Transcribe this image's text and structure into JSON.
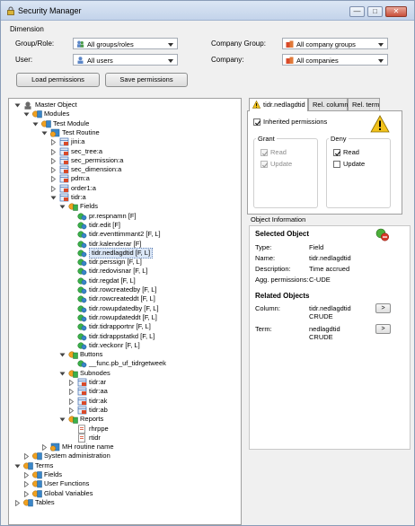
{
  "window": {
    "title": "Security Manager",
    "minimize": "—",
    "maximize": "□",
    "close": "✕"
  },
  "dimension": {
    "legend": "Dimension",
    "group_role_label": "Group/Role:",
    "group_role_value": "All groups/roles",
    "user_label": "User:",
    "user_value": "All users",
    "company_group_label": "Company Group:",
    "company_group_value": "All company groups",
    "company_label": "Company:",
    "company_value": "All companies"
  },
  "buttons": {
    "load": "Load permissions",
    "save": "Save permissions"
  },
  "tree": [
    {
      "label": "Master Object",
      "depth": 0,
      "exp": "minus",
      "icon": "master-icon"
    },
    {
      "label": "Modules",
      "depth": 1,
      "exp": "minus",
      "icon": "module-icon"
    },
    {
      "label": "Test Module",
      "depth": 2,
      "exp": "minus",
      "icon": "module-icon"
    },
    {
      "label": "Test Routine",
      "depth": 3,
      "exp": "minus",
      "icon": "routine-icon"
    },
    {
      "label": "jini:a",
      "depth": 4,
      "exp": "plus",
      "icon": "table-icon"
    },
    {
      "label": "sec_tree:a",
      "depth": 4,
      "exp": "plus",
      "icon": "table-icon"
    },
    {
      "label": "sec_permission:a",
      "depth": 4,
      "exp": "plus",
      "icon": "table-icon"
    },
    {
      "label": "sec_dimension:a",
      "depth": 4,
      "exp": "plus",
      "icon": "table-icon"
    },
    {
      "label": "pdm:a",
      "depth": 4,
      "exp": "plus",
      "icon": "table-icon"
    },
    {
      "label": "order1:a",
      "depth": 4,
      "exp": "plus",
      "icon": "table-icon"
    },
    {
      "label": "tidr:a",
      "depth": 4,
      "exp": "minus",
      "icon": "table-icon"
    },
    {
      "label": "Fields",
      "depth": 5,
      "exp": "minus",
      "icon": "folder-icon"
    },
    {
      "label": "pr.respnamn  [F]",
      "depth": 6,
      "exp": "",
      "icon": "field-icon"
    },
    {
      "label": "tidr.edit  [F]",
      "depth": 6,
      "exp": "",
      "icon": "field-icon"
    },
    {
      "label": "tidr.eventtimmant2  [F, L]",
      "depth": 6,
      "exp": "",
      "icon": "field-icon"
    },
    {
      "label": "tidr.kalenderar  [F]",
      "depth": 6,
      "exp": "",
      "icon": "field-icon"
    },
    {
      "label": "tidr.nedlagdtid  [F, L]",
      "depth": 6,
      "exp": "",
      "icon": "field-icon",
      "selected": true
    },
    {
      "label": "tidr.perssign  [F, L]",
      "depth": 6,
      "exp": "",
      "icon": "field-icon"
    },
    {
      "label": "tidr.redovisnar  [F, L]",
      "depth": 6,
      "exp": "",
      "icon": "field-icon"
    },
    {
      "label": "tidr.regdat  [F, L]",
      "depth": 6,
      "exp": "",
      "icon": "field-icon"
    },
    {
      "label": "tidr.rowcreatedby  [F, L]",
      "depth": 6,
      "exp": "",
      "icon": "field-icon"
    },
    {
      "label": "tidr.rowcreateddt  [F, L]",
      "depth": 6,
      "exp": "",
      "icon": "field-icon"
    },
    {
      "label": "tidr.rowupdatedby  [F, L]",
      "depth": 6,
      "exp": "",
      "icon": "field-icon"
    },
    {
      "label": "tidr.rowupdateddt  [F, L]",
      "depth": 6,
      "exp": "",
      "icon": "field-icon"
    },
    {
      "label": "tidr.tidrapportnr  [F, L]",
      "depth": 6,
      "exp": "",
      "icon": "field-icon"
    },
    {
      "label": "tidr.tidrappstatkd  [F, L]",
      "depth": 6,
      "exp": "",
      "icon": "field-icon"
    },
    {
      "label": "tidr.veckonr  [F, L]",
      "depth": 6,
      "exp": "",
      "icon": "field-icon"
    },
    {
      "label": "Buttons",
      "depth": 5,
      "exp": "minus",
      "icon": "folder-icon"
    },
    {
      "label": "__func.pb_uf_tidrgetweek",
      "depth": 6,
      "exp": "",
      "icon": "field-icon"
    },
    {
      "label": "Subnodes",
      "depth": 5,
      "exp": "minus",
      "icon": "folder-icon"
    },
    {
      "label": "tidr:ar",
      "depth": 6,
      "exp": "plus",
      "icon": "table-icon"
    },
    {
      "label": "tidr:aa",
      "depth": 6,
      "exp": "plus",
      "icon": "table-icon"
    },
    {
      "label": "tidr:ak",
      "depth": 6,
      "exp": "plus",
      "icon": "table-icon"
    },
    {
      "label": "tidr:ab",
      "depth": 6,
      "exp": "plus",
      "icon": "table-icon"
    },
    {
      "label": "Reports",
      "depth": 5,
      "exp": "minus",
      "icon": "folder-icon"
    },
    {
      "label": "rhrppe",
      "depth": 6,
      "exp": "",
      "icon": "report-icon"
    },
    {
      "label": "rtidr",
      "depth": 6,
      "exp": "",
      "icon": "report-icon"
    },
    {
      "label": "MH routine name",
      "depth": 3,
      "exp": "plus",
      "icon": "routine-icon"
    },
    {
      "label": "System administration",
      "depth": 1,
      "exp": "plus",
      "icon": "module-icon"
    },
    {
      "label": "Terms",
      "depth": 0,
      "exp": "minus",
      "icon": "module-icon"
    },
    {
      "label": "Fields",
      "depth": 1,
      "exp": "plus",
      "icon": "module-icon"
    },
    {
      "label": "User Functions",
      "depth": 1,
      "exp": "plus",
      "icon": "module-icon"
    },
    {
      "label": "Global Variables",
      "depth": 1,
      "exp": "plus",
      "icon": "module-icon"
    },
    {
      "label": "Tables",
      "depth": 0,
      "exp": "plus",
      "icon": "module-icon"
    }
  ],
  "tabs": [
    {
      "label": "tidr.nedlagdtid",
      "active": true
    },
    {
      "label": "Rel. column",
      "active": false
    },
    {
      "label": "Rel. term",
      "active": false
    }
  ],
  "permissions": {
    "inherited_label": "Inherited permissions",
    "inherited_checked": true,
    "grant_label": "Grant",
    "grant_read": "Read",
    "grant_update": "Update",
    "deny_label": "Deny",
    "deny_read": "Read",
    "deny_read_checked": true,
    "deny_update": "Update"
  },
  "object_info": {
    "title": "Object Information",
    "selected_heading": "Selected Object",
    "type_label": "Type:",
    "type_value": "Field",
    "name_label": "Name:",
    "name_value": "tidr.nedlagdtid",
    "desc_label": "Description:",
    "desc_value": "Time accrued",
    "agg_label": "Agg. permissions:",
    "agg_value": "C-UDE",
    "related_heading": "Related Objects",
    "column_label": "Column:",
    "column_value": "tidr.nedlagdtid",
    "column_perm": "CRUDE",
    "term_label": "Term:",
    "term_value": "nedlagdtid",
    "term_perm": "CRUDE",
    "goto_label": ">"
  }
}
